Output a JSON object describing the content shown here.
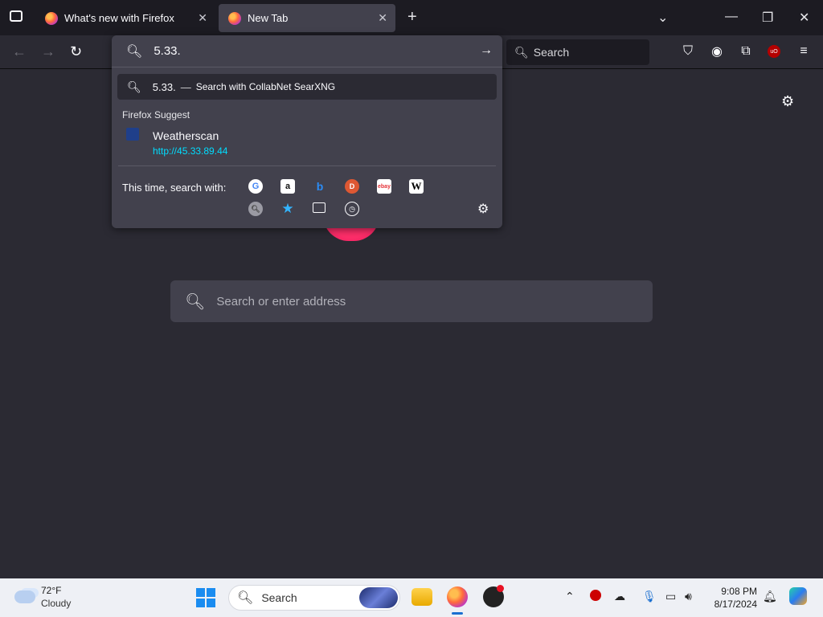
{
  "tabs": [
    {
      "title": "What's new with Firefox"
    },
    {
      "title": "New Tab"
    }
  ],
  "urlbar": {
    "value": "5.33.",
    "suggestion_text": "5.33.",
    "suggestion_separator": "—",
    "suggestion_action": "Search with CollabNet SearXNG"
  },
  "firefox_suggest": {
    "label": "Firefox Suggest",
    "title": "Weatherscan",
    "url": "http://45.33.89.44"
  },
  "search_with": {
    "label": "This time, search with:"
  },
  "toolbar": {
    "search_placeholder": "Search"
  },
  "newtab": {
    "search_placeholder": "Search or enter address"
  },
  "taskbar": {
    "temperature": "72°F",
    "condition": "Cloudy",
    "search_placeholder": "Search",
    "time": "9:08 PM",
    "date": "8/17/2024"
  }
}
